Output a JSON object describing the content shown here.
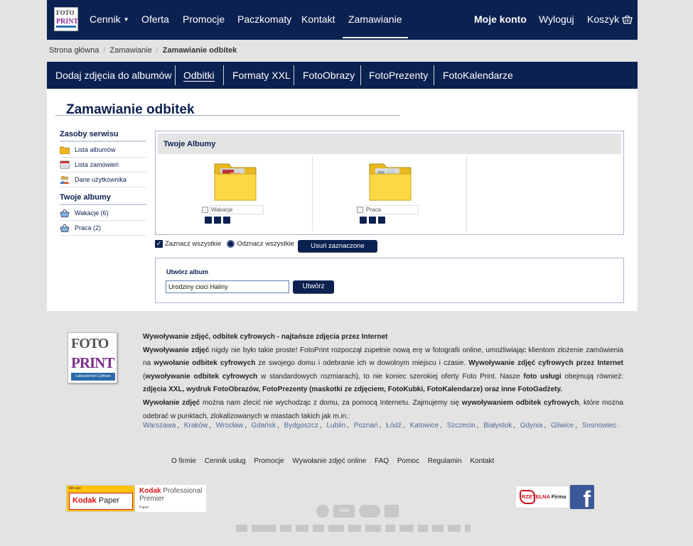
{
  "topnav": {
    "logo_top": "FOTO",
    "logo_bottom": "PRINT",
    "items": [
      {
        "label": "Cennik"
      },
      {
        "label": "Oferta"
      },
      {
        "label": "Promocje"
      },
      {
        "label": "Paczkomaty"
      },
      {
        "label": "Kontakt"
      },
      {
        "label": "Zamawianie"
      }
    ],
    "account": "Moje konto",
    "logout": "Wyloguj",
    "cart": "Koszyk",
    "icons": {
      "cart": "basket-icon",
      "dropdown": "caret-down-icon"
    }
  },
  "breadcrumb": {
    "items": [
      "Strona główna",
      "Zamawianie"
    ],
    "current": "Zamawianie odbitek"
  },
  "subnav": {
    "items": [
      {
        "label": "Dodaj zdjęcia do albumów"
      },
      {
        "label": "Odbitki"
      },
      {
        "label": "Formaty XXL"
      },
      {
        "label": "FotoObrazy"
      },
      {
        "label": "FotoPrezenty"
      },
      {
        "label": "FotoKalendarze"
      }
    ],
    "active": "Odbitki"
  },
  "page_title": "Zamawianie odbitek",
  "sidebar": {
    "resources_title": "Zasoby serwisu",
    "resources": [
      {
        "label": "Lista albumów",
        "icon": "folder-icon"
      },
      {
        "label": "Lista zamówień",
        "icon": "calendar-icon"
      },
      {
        "label": "Dane użytkownika",
        "icon": "users-icon"
      }
    ],
    "albums_title": "Twoje albumy",
    "albums": [
      {
        "label": "Wakacje (6)",
        "icon": "basket-icon"
      },
      {
        "label": "Praca (2)",
        "icon": "basket-icon"
      }
    ]
  },
  "albums_panel": {
    "title": "Twoje Albumy",
    "albums": [
      {
        "name": "Wakacje"
      },
      {
        "name": "Praca"
      }
    ]
  },
  "selection": {
    "select_all": "Zaznacz wszystkie",
    "deselect_all": "Odznacz wszystkie",
    "delete_selected": "Usuń zaznaczone"
  },
  "create_album": {
    "label": "Utwórz album",
    "input_value": "Urodziny cioci Haliny",
    "button": "Utwórz"
  },
  "footer": {
    "logo": {
      "top": "FOTO",
      "bottom": "PRINT",
      "sub": "Laboratorium Cyfrowe"
    },
    "heading": "Wywoływanie zdjęć, odbitek cyfrowych - najtańsze zdjęcia przez Internet",
    "p1_b1": "Wywoływanie zdjęć",
    "p1_t1": " nigdy nie było takie proste! FotoPrint rozpoczął zupełnie nową erę w fotografii online, umożliwiając klientom złożenie zamówienia na ",
    "p1_b2": "wywołanie odbitek cyfrowych",
    "p1_t2": " ze swojego domu i odebranie ich w dowolnym miejscu i czasie. ",
    "p1_b3": "Wywoływanie zdjęć cyfrowych przez Internet",
    "p1_t3": " (",
    "p1_b4": "wywoływanie odbitek cyfrowych",
    "p1_t4": " w standardowych rozmiarach), to nie koniec szerokiej oferty Foto Print. Nasze ",
    "p1_b5": "foto usługi",
    "p1_t5": " obejmują również: ",
    "p1_b6": "zdjęcia XXL, wydruk FotoObrazów, FotoPrezenty (maskotki ze zdjęciem, FotoKubki, FotoKalendarze) oraz inne FotoGadżety.",
    "p2_b1": "Wywołanie zdjęć",
    "p2_t1": " można nam zlecić nie wychodząc z domu, za pomocą Internetu. Zajmujemy się ",
    "p2_b2": "wywoływaniem odbitek cyfrowych",
    "p2_t2": ", które można odebrać w punktach, zlokalizowanych w miastach takich jak m.in.:",
    "cities": [
      "Warszawa",
      "Kraków",
      "Wrocław",
      "Gdańsk",
      "Bydgoszcz",
      "Lublin",
      "Poznań",
      "Łódź",
      "Katowice",
      "Szczecin",
      "Białystok",
      "Gdynia",
      "Gliwice",
      "Sosnowiec"
    ],
    "links": [
      "O firmie",
      "Cennik usług",
      "Promocje",
      "Wywołanie zdjęć online",
      "FAQ",
      "Pomoc",
      "Regulamin",
      "Kontakt"
    ],
    "kodak": {
      "we_use": "We use",
      "paper": "Kodak",
      "paper2": "Paper",
      "brand": "Kodak",
      "professional": " Professional",
      "premier": "Premier",
      "premier_sub": "Paper"
    },
    "rzetelna": {
      "a": "RZETELNA",
      "b": " Firma"
    },
    "facebook": "f",
    "payments": [
      "VISA"
    ]
  }
}
